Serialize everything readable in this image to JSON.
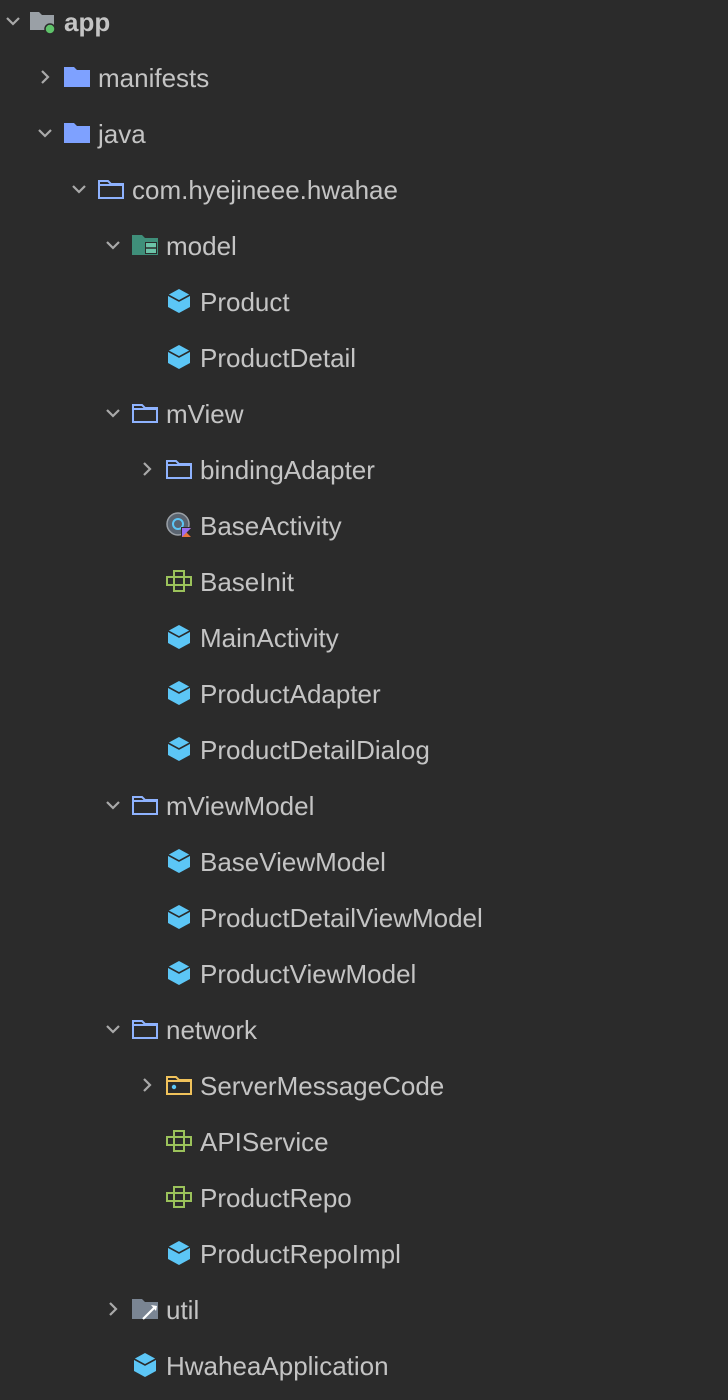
{
  "colors": {
    "background": "#2b2b2b",
    "text": "#c4c4c4",
    "chevron": "#a9a9a9",
    "folder_blue": "#7ea1ff",
    "package_outline": "#8fb3ff",
    "class_cyan": "#5cc6f6",
    "interface_green": "#9bc25b",
    "resources_teal": "#4aa68e",
    "enum_folder_orange": "#f0c25b",
    "module_gray": "#9aa0a6"
  },
  "tree": {
    "app": "app",
    "manifests": "manifests",
    "java": "java",
    "package": "com.hyejineee.hwahae",
    "model": "model",
    "model_product": "Product",
    "model_product_detail": "ProductDetail",
    "mview": "mView",
    "binding_adapter": "bindingAdapter",
    "base_activity": "BaseActivity",
    "base_init": "BaseInit",
    "main_activity": "MainActivity",
    "product_adapter": "ProductAdapter",
    "product_detail_dialog": "ProductDetailDialog",
    "mviewmodel": "mViewModel",
    "base_view_model": "BaseViewModel",
    "product_detail_view_model": "ProductDetailViewModel",
    "product_view_model": "ProductViewModel",
    "network": "network",
    "server_message_code": "ServerMessageCode",
    "api_service": "APIService",
    "product_repo": "ProductRepo",
    "product_repo_impl": "ProductRepoImpl",
    "util": "util",
    "hwahea_application": "HwaheaApplication"
  }
}
